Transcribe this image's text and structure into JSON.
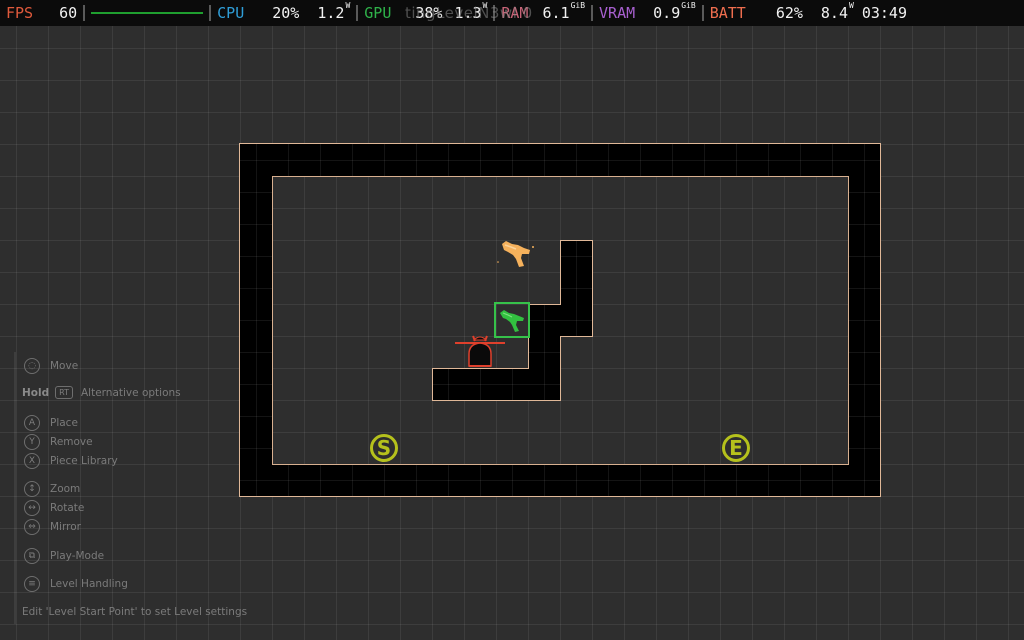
{
  "hud": {
    "fps_label": "FPS",
    "fps_value": "60",
    "cpu_label": "CPU",
    "cpu_pct": "20%",
    "cpu_power": "1.2",
    "cpu_power_unit": "W",
    "gpu_label": "GPU",
    "gpu_pct": "38%",
    "gpu_power": "1.3",
    "gpu_power_unit": "W",
    "ram_label": "RAM",
    "ram_value": "6.1",
    "ram_unit": "GiB",
    "vram_label": "VRAM",
    "vram_value": "0.9",
    "vram_unit": "GiB",
    "batt_label": "BATT",
    "batt_pct": "62%",
    "batt_power": "8.4",
    "batt_power_unit": "W",
    "clock": "03:49",
    "colors": {
      "fps": "#e05a3c",
      "cpu": "#2f9ed8",
      "gpu": "#2fb34a",
      "ram": "#c86478",
      "vram": "#a860d0",
      "batt": "#ef6e4f"
    }
  },
  "ghost_title": "tingLevelN3wl  0",
  "level": {
    "start_marker": "S",
    "end_marker": "E"
  },
  "help": {
    "move": "Move",
    "hold": "Hold",
    "rt": "RT",
    "alt_options": "Alternative options",
    "a_btn": "A",
    "place": "Place",
    "y_btn": "Y",
    "remove": "Remove",
    "x_btn": "X",
    "piece_library": "Piece Library",
    "zoom": "Zoom",
    "rotate": "Rotate",
    "mirror": "Mirror",
    "play_mode": "Play-Mode",
    "level_handling": "Level Handling",
    "hint": "Edit 'Level Start Point' to set Level settings"
  }
}
